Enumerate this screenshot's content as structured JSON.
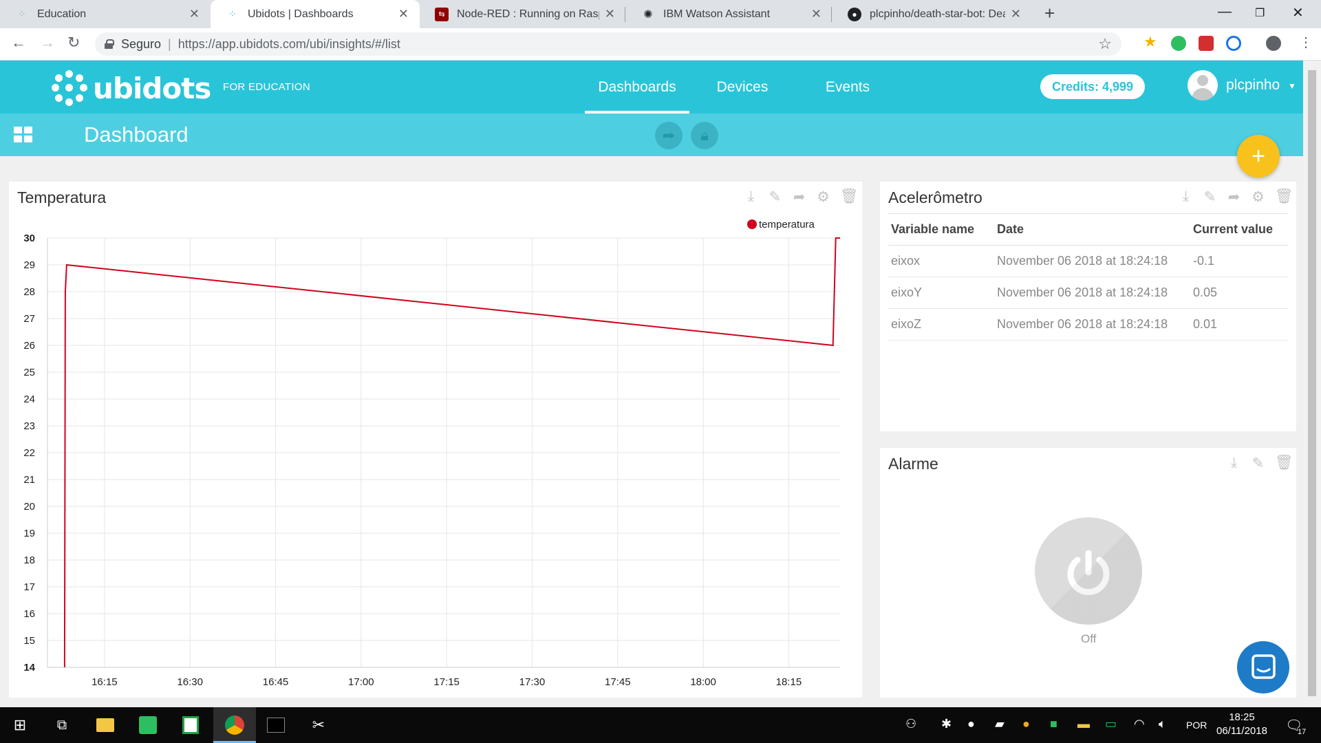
{
  "browser": {
    "tabs": [
      {
        "title": "Education",
        "favicon": "ubidots-favicon",
        "active": false
      },
      {
        "title": "Ubidots | Dashboards",
        "favicon": "ubidots-favicon",
        "active": true
      },
      {
        "title": "Node-RED : Running on Raspberr",
        "favicon": "node-red-favicon",
        "active": false
      },
      {
        "title": "IBM Watson Assistant",
        "favicon": "watson-favicon",
        "active": false
      },
      {
        "title": "plcpinho/death-star-bot: Death S",
        "favicon": "github-favicon",
        "active": false
      }
    ],
    "secure_label": "Seguro",
    "url": "https://app.ubidots.com/ubi/insights/#/list"
  },
  "header": {
    "brand": "ubidots",
    "edition": "FOR EDUCATION",
    "nav": [
      {
        "label": "Dashboards",
        "active": true
      },
      {
        "label": "Devices",
        "active": false
      },
      {
        "label": "Events",
        "active": false
      }
    ],
    "credits": "Credits: 4,999",
    "username": "plcpinho"
  },
  "subheader": {
    "title": "Dashboard"
  },
  "widgets": {
    "temperatura": {
      "title": "Temperatura",
      "legend": "temperatura"
    },
    "acelerometro": {
      "title": "Acelerômetro",
      "columns": [
        "Variable name",
        "Date",
        "Current value"
      ],
      "rows": [
        {
          "name": "eixox",
          "date": "November 06 2018 at 18:24:18",
          "value": "-0.1"
        },
        {
          "name": "eixoY",
          "date": "November 06 2018 at 18:24:18",
          "value": "0.05"
        },
        {
          "name": "eixoZ",
          "date": "November 06 2018 at 18:24:18",
          "value": "0.01"
        }
      ]
    },
    "alarme": {
      "title": "Alarme",
      "state": "Off"
    }
  },
  "chart_data": {
    "type": "line",
    "title": "Temperatura",
    "xlabel": "",
    "ylabel": "",
    "series": [
      {
        "name": "temperatura",
        "color": "#d0021b",
        "points": [
          {
            "x": "16:08",
            "y": 14
          },
          {
            "x": "16:08",
            "y": 28
          },
          {
            "x": "16:08",
            "y": 28
          },
          {
            "x": "16:08",
            "y": 29
          },
          {
            "x": "18:23",
            "y": 26
          },
          {
            "x": "18:23",
            "y": 30
          },
          {
            "x": "18:24",
            "y": 30
          }
        ]
      }
    ],
    "x_ticks": [
      "16:15",
      "16:30",
      "16:45",
      "17:00",
      "17:15",
      "17:30",
      "17:45",
      "18:00",
      "18:15"
    ],
    "y_ticks": [
      14,
      15,
      16,
      17,
      18,
      19,
      20,
      21,
      22,
      23,
      24,
      25,
      26,
      27,
      28,
      29,
      30
    ],
    "xlim": [
      "16:05",
      "18:24"
    ],
    "ylim": [
      14,
      30
    ],
    "grid": true,
    "legend_position": "top-right"
  },
  "taskbar": {
    "language": "POR",
    "time": "18:25",
    "date": "06/11/2018",
    "notifications": "17"
  }
}
